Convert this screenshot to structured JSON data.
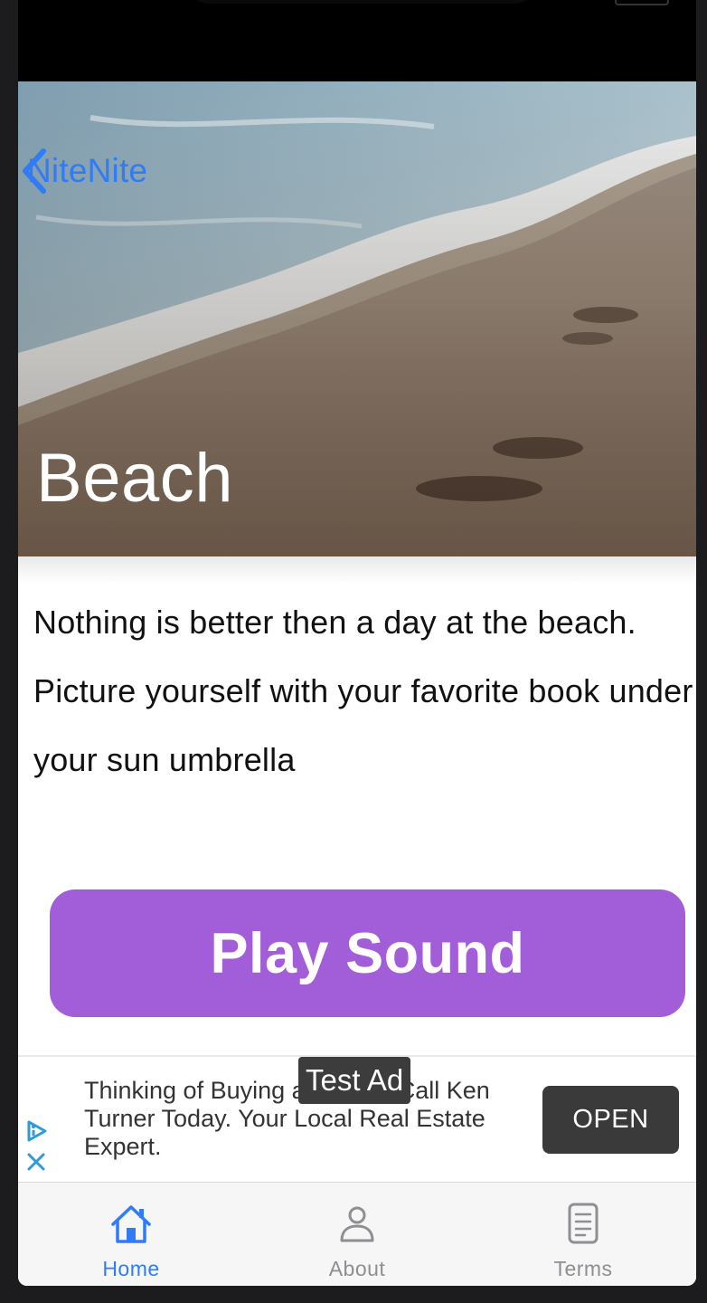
{
  "nav": {
    "back_label": "NiteNite"
  },
  "hero": {
    "title": "Beach"
  },
  "description": "Nothing is better then a day at the beach. Picture yourself with your favorite book under your sun umbrella",
  "play_button": {
    "label": "Play Sound",
    "color": "#a25ed9"
  },
  "ad": {
    "tag": "Test Ad",
    "text": "Thinking of Buying a Home? Call Ken Turner Today. Your Local Real Estate Expert.",
    "cta": "OPEN"
  },
  "tabbar": {
    "active_color": "#2f7cf6",
    "tabs": [
      {
        "label": "Home",
        "icon": "house-icon",
        "active": true
      },
      {
        "label": "About",
        "icon": "person-icon",
        "active": false
      },
      {
        "label": "Terms",
        "icon": "document-icon",
        "active": false
      }
    ]
  }
}
